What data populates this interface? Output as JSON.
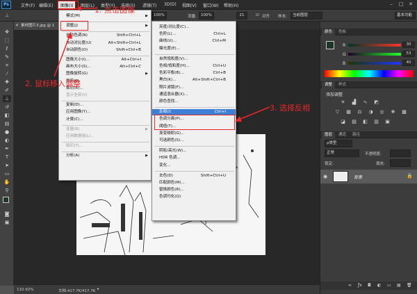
{
  "menubar": {
    "items": [
      "文件(F)",
      "编辑(E)",
      "图像(I)",
      "图层(L)",
      "类型(Y)",
      "选择(S)",
      "滤镜(T)",
      "3D(D)",
      "视图(V)",
      "窗口(W)",
      "帮助(H)"
    ],
    "logo": "Ps"
  },
  "options": {
    "zoom": "100%",
    "flow_label": "流量:",
    "flow_value": "100%",
    "size": "21",
    "align_label": "对齐",
    "sample_label": "样本:",
    "sample_value": "当前图层",
    "workspace": "基本功能"
  },
  "document": {
    "tab_title": "素材图片3.jpg @ 1",
    "zoom": "110.92%",
    "docinfo": "文档:417.7K/417.7K"
  },
  "image_menu": [
    {
      "label": "模式(M)",
      "shortcut": "",
      "submenu": true,
      "disabled": false
    },
    {
      "sep": true
    },
    {
      "label": "调整(J)",
      "shortcut": "",
      "submenu": true,
      "disabled": false
    },
    {
      "sep": true
    },
    {
      "label": "自动色调(N)",
      "shortcut": "Shift+Ctrl+L",
      "disabled": false
    },
    {
      "label": "自动对比度(U)",
      "shortcut": "Alt+Shift+Ctrl+L",
      "disabled": false
    },
    {
      "label": "自动颜色(O)",
      "shortcut": "Shift+Ctrl+B",
      "disabled": false
    },
    {
      "sep": true
    },
    {
      "label": "图像大小(I)...",
      "shortcut": "Alt+Ctrl+I",
      "disabled": false
    },
    {
      "label": "画布大小(S)...",
      "shortcut": "Alt+Ctrl+C",
      "disabled": false
    },
    {
      "label": "图像旋转(G)",
      "shortcut": "",
      "submenu": true,
      "disabled": false
    },
    {
      "label": "裁剪(P)",
      "shortcut": "",
      "disabled": false
    },
    {
      "label": "裁切(R)...",
      "shortcut": "",
      "disabled": false
    },
    {
      "label": "显示全部(V)",
      "shortcut": "",
      "disabled": true
    },
    {
      "sep": true
    },
    {
      "label": "复制(D)...",
      "shortcut": "",
      "disabled": false
    },
    {
      "label": "应用图像(Y)...",
      "shortcut": "",
      "disabled": false
    },
    {
      "label": "计算(C)...",
      "shortcut": "",
      "disabled": false
    },
    {
      "sep": true
    },
    {
      "label": "变量(B)",
      "shortcut": "",
      "submenu": true,
      "disabled": true
    },
    {
      "label": "应用数据组(L)...",
      "shortcut": "",
      "disabled": true
    },
    {
      "sep": true
    },
    {
      "label": "陷印(T)...",
      "shortcut": "",
      "disabled": true
    },
    {
      "sep": true
    },
    {
      "label": "分析(A)",
      "shortcut": "",
      "submenu": true,
      "disabled": false
    }
  ],
  "adjust_menu": [
    {
      "label": "亮度/对比度(C)...",
      "shortcut": ""
    },
    {
      "label": "色阶(L)...",
      "shortcut": "Ctrl+L"
    },
    {
      "label": "曲线(U)...",
      "shortcut": "Ctrl+M"
    },
    {
      "label": "曝光度(E)...",
      "shortcut": ""
    },
    {
      "sep": true
    },
    {
      "label": "自然饱和度(V)...",
      "shortcut": ""
    },
    {
      "label": "色相/饱和度(H)...",
      "shortcut": "Ctrl+U"
    },
    {
      "label": "色彩平衡(B)...",
      "shortcut": "Ctrl+B"
    },
    {
      "label": "黑白(K)...",
      "shortcut": "Alt+Shift+Ctrl+B"
    },
    {
      "label": "照片滤镜(F)...",
      "shortcut": ""
    },
    {
      "label": "通道混合器(X)...",
      "shortcut": ""
    },
    {
      "label": "颜色查找...",
      "shortcut": ""
    },
    {
      "sep": true
    },
    {
      "label": "反相(I)",
      "shortcut": "Ctrl+I",
      "highlight": true
    },
    {
      "label": "色调分离(P)...",
      "shortcut": ""
    },
    {
      "label": "阈值(T)...",
      "shortcut": ""
    },
    {
      "label": "渐变映射(G)...",
      "shortcut": ""
    },
    {
      "label": "可选颜色(S)...",
      "shortcut": ""
    },
    {
      "sep": true
    },
    {
      "label": "阴影/高光(W)...",
      "shortcut": ""
    },
    {
      "label": "HDR 色调...",
      "shortcut": ""
    },
    {
      "label": "变化...",
      "shortcut": ""
    },
    {
      "sep": true
    },
    {
      "label": "去色(D)",
      "shortcut": "Shift+Ctrl+U"
    },
    {
      "label": "匹配颜色(M)...",
      "shortcut": ""
    },
    {
      "label": "替换颜色(R)...",
      "shortcut": ""
    },
    {
      "label": "色调均化(Q)",
      "shortcut": ""
    }
  ],
  "annotations": {
    "step1": "1. 点击图像",
    "step2": "2. 鼠标移入调整",
    "step3": "3. 选择反相"
  },
  "color_panel": {
    "tabs": [
      "颜色",
      "色板"
    ],
    "channels": [
      {
        "name": "R",
        "value": "30"
      },
      {
        "name": "G",
        "value": "53"
      },
      {
        "name": "B",
        "value": "40"
      }
    ],
    "fg_color": "#1e3528"
  },
  "adjust_panel": {
    "tabs": [
      "调整",
      "样式"
    ],
    "title": "添加调整"
  },
  "layers_panel": {
    "tabs": [
      "图层",
      "通道",
      "路径"
    ],
    "kind_label": "ρ类型",
    "blend_mode": "正常",
    "opacity_label": "不透明度:",
    "lock_label": "锁定:",
    "fill_label": "填充:",
    "layer_name": "背景"
  }
}
